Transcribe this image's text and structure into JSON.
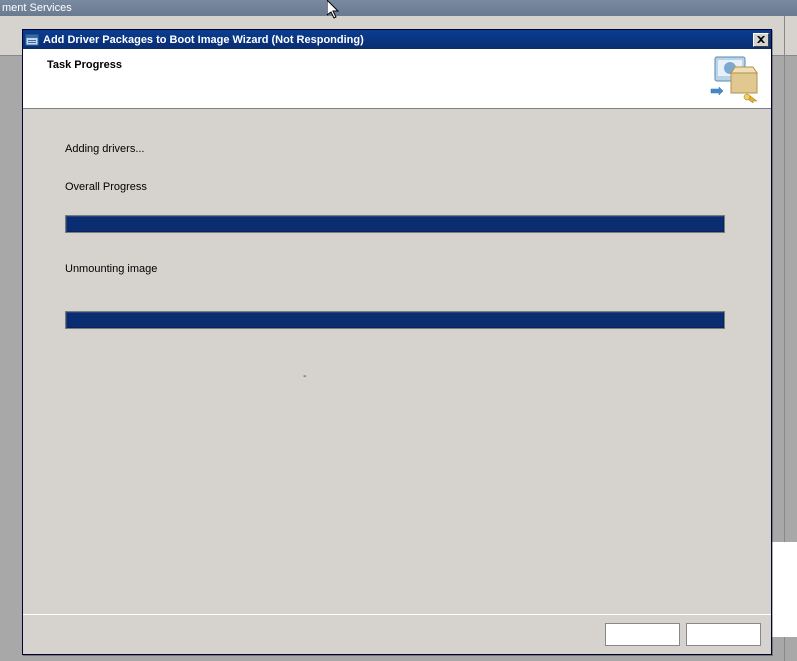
{
  "background": {
    "partial_title": "ment Services"
  },
  "wizard": {
    "title": "Add Driver Packages to Boot Image Wizard (Not Responding)",
    "header_title": "Task Progress",
    "status_text": "Adding drivers...",
    "overall_label": "Overall Progress",
    "overall_percent": 100,
    "subtask_label": "Unmounting image",
    "subtask_percent": 100,
    "close_label": "X"
  }
}
